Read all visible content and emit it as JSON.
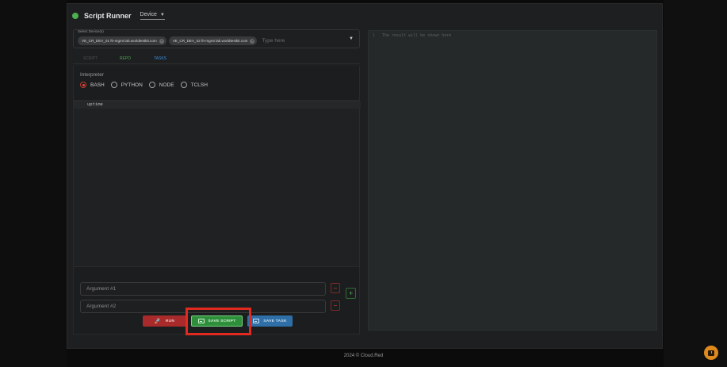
{
  "header": {
    "title": "Script Runner",
    "device_select": "Device"
  },
  "device_field": {
    "label": "Select Device(s)",
    "chips": [
      "VE_CR_DEV_01 f0-mgmt lab.worldtestkit.com",
      "VE_CR_DEV_02 f0-mgmt lab.worldtestkit.com"
    ],
    "placeholder": "Type here"
  },
  "tabs": [
    "SCRIPT",
    "REPO",
    "TASKS"
  ],
  "interpreter": {
    "label": "Interpreter",
    "options": [
      "BASH",
      "PYTHON",
      "NODE",
      "TCLSH"
    ],
    "selected": "BASH"
  },
  "editor": {
    "code": "uptime"
  },
  "arguments": {
    "arg1_placeholder": "Argument #1",
    "arg2_placeholder": "Argument #2",
    "remove_symbol": "−",
    "add_symbol": "+"
  },
  "actions": {
    "run": "RUN",
    "save_script": "SAVE SCRIPT",
    "save_task": "SAVE TASK"
  },
  "result": {
    "line_number": "1",
    "placeholder": "The result will be shown here"
  },
  "footer": {
    "text": "2024 © Cloud.Red"
  },
  "colors": {
    "status_dot": "#4caf50",
    "run": "#a82a2a",
    "save_script": "#2e8f3a",
    "save_task": "#2f6fa7",
    "highlight": "#e02a1f",
    "chat_fab": "#e08a1e"
  },
  "icons": {
    "run": "rocket-icon",
    "save_script": "save-icon",
    "save_task": "save-icon",
    "chat": "chat-icon"
  }
}
